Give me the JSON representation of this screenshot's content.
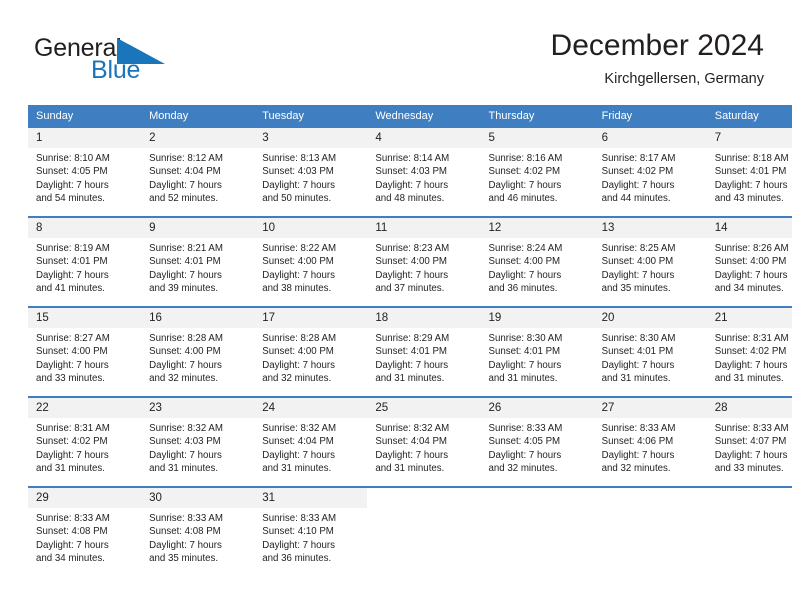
{
  "brand": {
    "name_dark": "General",
    "name_blue": "Blue",
    "triangle_color": "#1b75bb"
  },
  "header": {
    "title": "December 2024",
    "subtitle": "Kirchgellersen, Germany"
  },
  "theme": {
    "header_blue": "#3f7fc1",
    "daynum_background": "#f2f2f2",
    "text": "#231f20"
  },
  "weekday_headers": [
    "Sunday",
    "Monday",
    "Tuesday",
    "Wednesday",
    "Thursday",
    "Friday",
    "Saturday"
  ],
  "weeks": [
    [
      {
        "day": "1",
        "sunrise": "Sunrise: 8:10 AM",
        "sunset": "Sunset: 4:05 PM",
        "daylight_line1": "Daylight: 7 hours",
        "daylight_line2": "and 54 minutes."
      },
      {
        "day": "2",
        "sunrise": "Sunrise: 8:12 AM",
        "sunset": "Sunset: 4:04 PM",
        "daylight_line1": "Daylight: 7 hours",
        "daylight_line2": "and 52 minutes."
      },
      {
        "day": "3",
        "sunrise": "Sunrise: 8:13 AM",
        "sunset": "Sunset: 4:03 PM",
        "daylight_line1": "Daylight: 7 hours",
        "daylight_line2": "and 50 minutes."
      },
      {
        "day": "4",
        "sunrise": "Sunrise: 8:14 AM",
        "sunset": "Sunset: 4:03 PM",
        "daylight_line1": "Daylight: 7 hours",
        "daylight_line2": "and 48 minutes."
      },
      {
        "day": "5",
        "sunrise": "Sunrise: 8:16 AM",
        "sunset": "Sunset: 4:02 PM",
        "daylight_line1": "Daylight: 7 hours",
        "daylight_line2": "and 46 minutes."
      },
      {
        "day": "6",
        "sunrise": "Sunrise: 8:17 AM",
        "sunset": "Sunset: 4:02 PM",
        "daylight_line1": "Daylight: 7 hours",
        "daylight_line2": "and 44 minutes."
      },
      {
        "day": "7",
        "sunrise": "Sunrise: 8:18 AM",
        "sunset": "Sunset: 4:01 PM",
        "daylight_line1": "Daylight: 7 hours",
        "daylight_line2": "and 43 minutes."
      }
    ],
    [
      {
        "day": "8",
        "sunrise": "Sunrise: 8:19 AM",
        "sunset": "Sunset: 4:01 PM",
        "daylight_line1": "Daylight: 7 hours",
        "daylight_line2": "and 41 minutes."
      },
      {
        "day": "9",
        "sunrise": "Sunrise: 8:21 AM",
        "sunset": "Sunset: 4:01 PM",
        "daylight_line1": "Daylight: 7 hours",
        "daylight_line2": "and 39 minutes."
      },
      {
        "day": "10",
        "sunrise": "Sunrise: 8:22 AM",
        "sunset": "Sunset: 4:00 PM",
        "daylight_line1": "Daylight: 7 hours",
        "daylight_line2": "and 38 minutes."
      },
      {
        "day": "11",
        "sunrise": "Sunrise: 8:23 AM",
        "sunset": "Sunset: 4:00 PM",
        "daylight_line1": "Daylight: 7 hours",
        "daylight_line2": "and 37 minutes."
      },
      {
        "day": "12",
        "sunrise": "Sunrise: 8:24 AM",
        "sunset": "Sunset: 4:00 PM",
        "daylight_line1": "Daylight: 7 hours",
        "daylight_line2": "and 36 minutes."
      },
      {
        "day": "13",
        "sunrise": "Sunrise: 8:25 AM",
        "sunset": "Sunset: 4:00 PM",
        "daylight_line1": "Daylight: 7 hours",
        "daylight_line2": "and 35 minutes."
      },
      {
        "day": "14",
        "sunrise": "Sunrise: 8:26 AM",
        "sunset": "Sunset: 4:00 PM",
        "daylight_line1": "Daylight: 7 hours",
        "daylight_line2": "and 34 minutes."
      }
    ],
    [
      {
        "day": "15",
        "sunrise": "Sunrise: 8:27 AM",
        "sunset": "Sunset: 4:00 PM",
        "daylight_line1": "Daylight: 7 hours",
        "daylight_line2": "and 33 minutes."
      },
      {
        "day": "16",
        "sunrise": "Sunrise: 8:28 AM",
        "sunset": "Sunset: 4:00 PM",
        "daylight_line1": "Daylight: 7 hours",
        "daylight_line2": "and 32 minutes."
      },
      {
        "day": "17",
        "sunrise": "Sunrise: 8:28 AM",
        "sunset": "Sunset: 4:00 PM",
        "daylight_line1": "Daylight: 7 hours",
        "daylight_line2": "and 32 minutes."
      },
      {
        "day": "18",
        "sunrise": "Sunrise: 8:29 AM",
        "sunset": "Sunset: 4:01 PM",
        "daylight_line1": "Daylight: 7 hours",
        "daylight_line2": "and 31 minutes."
      },
      {
        "day": "19",
        "sunrise": "Sunrise: 8:30 AM",
        "sunset": "Sunset: 4:01 PM",
        "daylight_line1": "Daylight: 7 hours",
        "daylight_line2": "and 31 minutes."
      },
      {
        "day": "20",
        "sunrise": "Sunrise: 8:30 AM",
        "sunset": "Sunset: 4:01 PM",
        "daylight_line1": "Daylight: 7 hours",
        "daylight_line2": "and 31 minutes."
      },
      {
        "day": "21",
        "sunrise": "Sunrise: 8:31 AM",
        "sunset": "Sunset: 4:02 PM",
        "daylight_line1": "Daylight: 7 hours",
        "daylight_line2": "and 31 minutes."
      }
    ],
    [
      {
        "day": "22",
        "sunrise": "Sunrise: 8:31 AM",
        "sunset": "Sunset: 4:02 PM",
        "daylight_line1": "Daylight: 7 hours",
        "daylight_line2": "and 31 minutes."
      },
      {
        "day": "23",
        "sunrise": "Sunrise: 8:32 AM",
        "sunset": "Sunset: 4:03 PM",
        "daylight_line1": "Daylight: 7 hours",
        "daylight_line2": "and 31 minutes."
      },
      {
        "day": "24",
        "sunrise": "Sunrise: 8:32 AM",
        "sunset": "Sunset: 4:04 PM",
        "daylight_line1": "Daylight: 7 hours",
        "daylight_line2": "and 31 minutes."
      },
      {
        "day": "25",
        "sunrise": "Sunrise: 8:32 AM",
        "sunset": "Sunset: 4:04 PM",
        "daylight_line1": "Daylight: 7 hours",
        "daylight_line2": "and 31 minutes."
      },
      {
        "day": "26",
        "sunrise": "Sunrise: 8:33 AM",
        "sunset": "Sunset: 4:05 PM",
        "daylight_line1": "Daylight: 7 hours",
        "daylight_line2": "and 32 minutes."
      },
      {
        "day": "27",
        "sunrise": "Sunrise: 8:33 AM",
        "sunset": "Sunset: 4:06 PM",
        "daylight_line1": "Daylight: 7 hours",
        "daylight_line2": "and 32 minutes."
      },
      {
        "day": "28",
        "sunrise": "Sunrise: 8:33 AM",
        "sunset": "Sunset: 4:07 PM",
        "daylight_line1": "Daylight: 7 hours",
        "daylight_line2": "and 33 minutes."
      }
    ],
    [
      {
        "day": "29",
        "sunrise": "Sunrise: 8:33 AM",
        "sunset": "Sunset: 4:08 PM",
        "daylight_line1": "Daylight: 7 hours",
        "daylight_line2": "and 34 minutes."
      },
      {
        "day": "30",
        "sunrise": "Sunrise: 8:33 AM",
        "sunset": "Sunset: 4:08 PM",
        "daylight_line1": "Daylight: 7 hours",
        "daylight_line2": "and 35 minutes."
      },
      {
        "day": "31",
        "sunrise": "Sunrise: 8:33 AM",
        "sunset": "Sunset: 4:10 PM",
        "daylight_line1": "Daylight: 7 hours",
        "daylight_line2": "and 36 minutes."
      },
      {
        "day": "",
        "sunrise": "",
        "sunset": "",
        "daylight_line1": "",
        "daylight_line2": ""
      },
      {
        "day": "",
        "sunrise": "",
        "sunset": "",
        "daylight_line1": "",
        "daylight_line2": ""
      },
      {
        "day": "",
        "sunrise": "",
        "sunset": "",
        "daylight_line1": "",
        "daylight_line2": ""
      },
      {
        "day": "",
        "sunrise": "",
        "sunset": "",
        "daylight_line1": "",
        "daylight_line2": ""
      }
    ]
  ]
}
